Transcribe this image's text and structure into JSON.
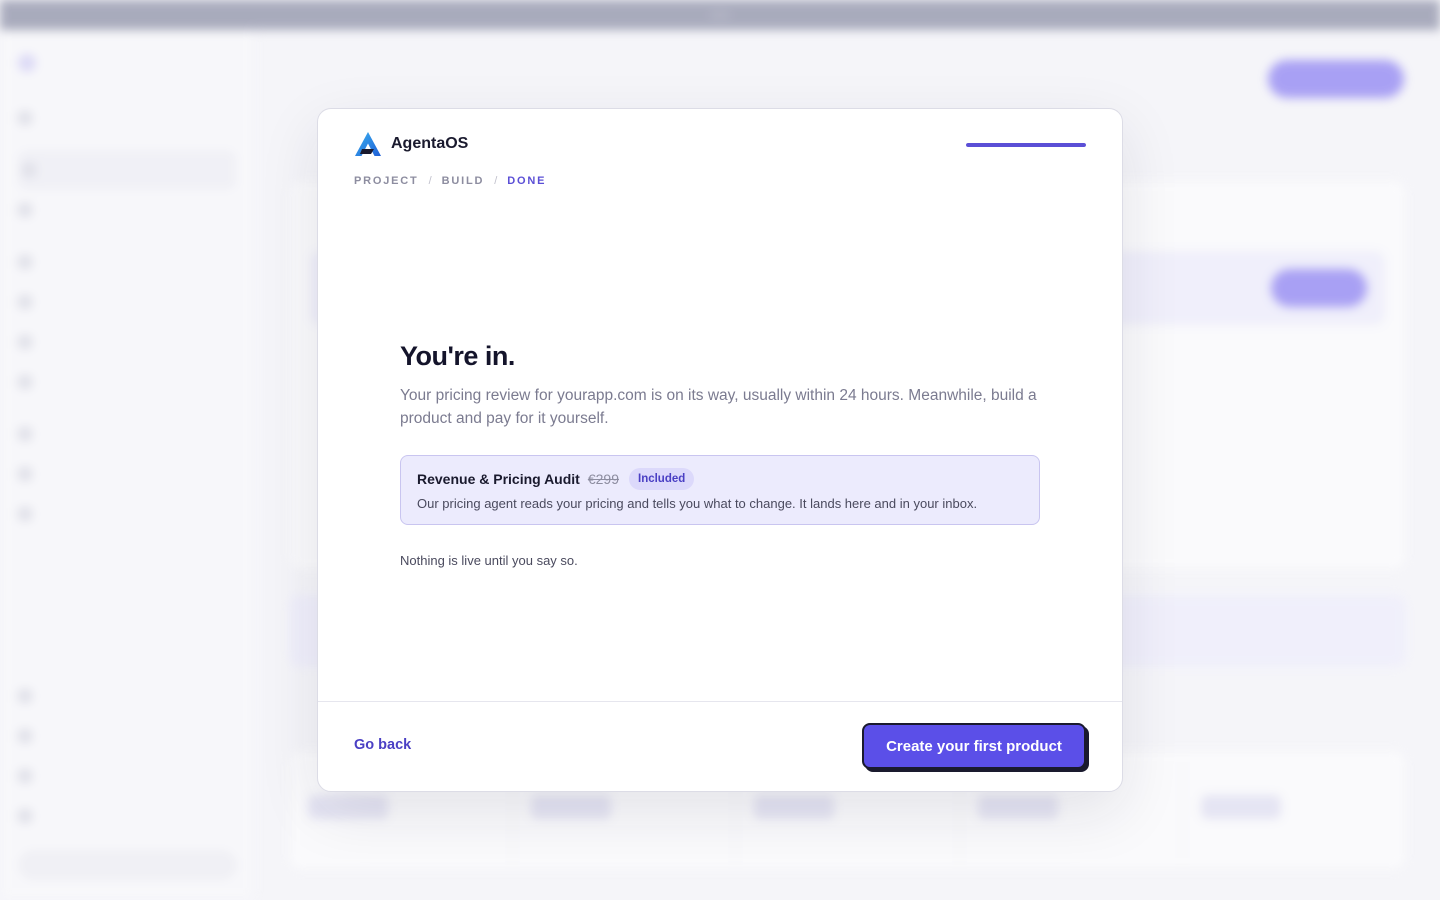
{
  "brand": {
    "name": "AgentaOS"
  },
  "steps": [
    {
      "label": "PROJECT"
    },
    {
      "label": "BUILD"
    },
    {
      "label": "DONE"
    }
  ],
  "step_separator": "/",
  "progress": {
    "fraction": 1.0
  },
  "content": {
    "headline": "You're in.",
    "lead": "Your pricing review for yourapp.com is on its way, usually within 24 hours. Meanwhile, build a product and pay for it yourself.",
    "audit": {
      "title": "Revenue & Pricing Audit",
      "original_price": "€299",
      "badge": "Included",
      "description": "Our pricing agent reads your pricing and tells you what to change. It lands here and in your inbox."
    },
    "note": "Nothing is live until you say so."
  },
  "footer": {
    "back_label": "Go back",
    "primary_label": "Create your first product"
  },
  "colors": {
    "accent": "#5b4fe8",
    "accent_text": "#4a3fc4",
    "audit_bg": "#ecebfd",
    "badge_bg": "#dcd9fb"
  }
}
